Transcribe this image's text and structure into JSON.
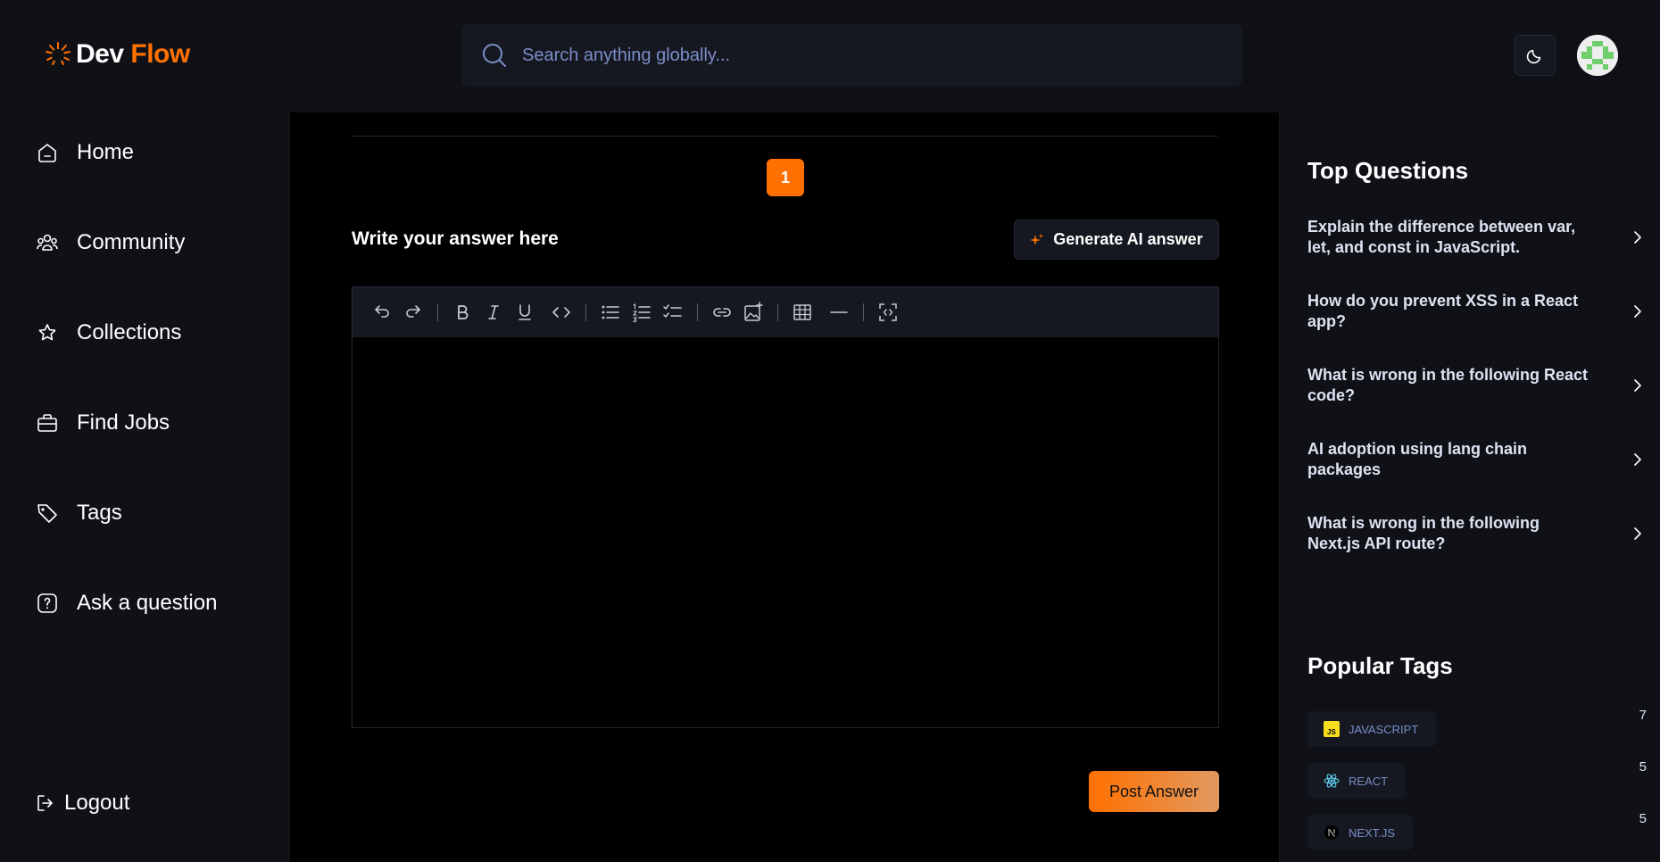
{
  "header": {
    "logo_part1": "Dev",
    "logo_part2": "Flow",
    "search_placeholder": "Search anything globally...",
    "theme_icon": "moon-icon",
    "accent_color": "#ff7000"
  },
  "sidebar": {
    "items": [
      {
        "label": "Home",
        "icon": "home-icon"
      },
      {
        "label": "Community",
        "icon": "users-icon"
      },
      {
        "label": "Collections",
        "icon": "star-icon"
      },
      {
        "label": "Find Jobs",
        "icon": "suitcase-icon"
      },
      {
        "label": "Tags",
        "icon": "tag-icon"
      },
      {
        "label": "Ask a question",
        "icon": "question-icon"
      }
    ],
    "logout_label": "Logout"
  },
  "main": {
    "page_number": "1",
    "answer_label": "Write your answer here",
    "ai_button_label": "Generate AI answer",
    "post_button_label": "Post Answer",
    "toolbar_tools": [
      "undo",
      "redo",
      "bold",
      "italic",
      "underline",
      "code",
      "bullet-list",
      "numbered-list",
      "check-list",
      "link",
      "image",
      "table",
      "horizontal-rule",
      "source"
    ]
  },
  "right": {
    "top_questions_title": "Top Questions",
    "top_questions": [
      "Explain the difference between var, let, and const in JavaScript.",
      "How do you prevent XSS in a React app?",
      "What is wrong in the following React code?",
      "AI adoption using lang chain packages",
      "What is wrong in the following Next.js API route?"
    ],
    "popular_tags_title": "Popular Tags",
    "tags": [
      {
        "name": "JAVASCRIPT",
        "count": "7",
        "icon": "javascript-icon"
      },
      {
        "name": "REACT",
        "count": "5",
        "icon": "react-icon"
      },
      {
        "name": "NEXT.JS",
        "count": "5",
        "icon": "nextjs-icon"
      }
    ]
  }
}
